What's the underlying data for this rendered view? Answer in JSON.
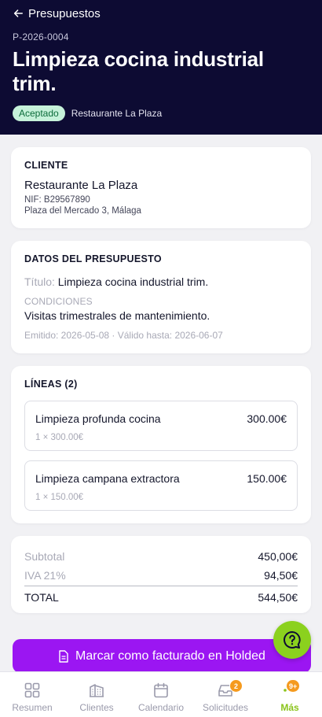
{
  "header": {
    "back_label": "Presupuestos",
    "reference": "P-2026-0004",
    "title": "Limpieza cocina industrial trim.",
    "status_badge": "Aceptado",
    "client": "Restaurante La Plaza"
  },
  "client_card": {
    "title": "CLIENTE",
    "name": "Restaurante La Plaza",
    "nif": "NIF: B29567890",
    "address": "Plaza del Mercado 3, Málaga"
  },
  "details_card": {
    "title": "DATOS DEL PRESUPUESTO",
    "title_label": "Título:",
    "title_value": "Limpieza cocina industrial trim.",
    "conditions_label": "CONDICIONES",
    "conditions_value": "Visitas trimestrales de mantenimiento.",
    "dates": "Emitido: 2026-05-08 · Válido hasta: 2026-06-07"
  },
  "lines_card": {
    "title": "LÍNEAS (2)",
    "items": [
      {
        "name": "Limpieza profunda cocina",
        "amount": "300.00€",
        "qty": "1 × 300.00€"
      },
      {
        "name": "Limpieza campana extractora",
        "amount": "150.00€",
        "qty": "1 × 150.00€"
      }
    ]
  },
  "totals": {
    "subtotal_label": "Subtotal",
    "subtotal_value": "450,00€",
    "tax_label": "IVA 21%",
    "tax_value": "94,50€",
    "total_label": "TOTAL",
    "total_value": "544,50€"
  },
  "action": {
    "label": "Marcar como facturado en Holded"
  },
  "tabbar": {
    "items": [
      {
        "label": "Resumen",
        "icon": "grid-icon"
      },
      {
        "label": "Clientes",
        "icon": "buildings-icon"
      },
      {
        "label": "Calendario",
        "icon": "calendar-icon"
      },
      {
        "label": "Solicitudes",
        "icon": "inbox-icon",
        "badge": "2"
      },
      {
        "label": "Más",
        "icon": "dots-icon",
        "badge": "9+"
      }
    ]
  },
  "colors": {
    "header_bg": "#0d0b33",
    "accent_purple": "#9b16f2",
    "accent_green": "#8bd11e",
    "badge_orange": "#f59a1e",
    "status_green_bg": "#c6f2da"
  }
}
